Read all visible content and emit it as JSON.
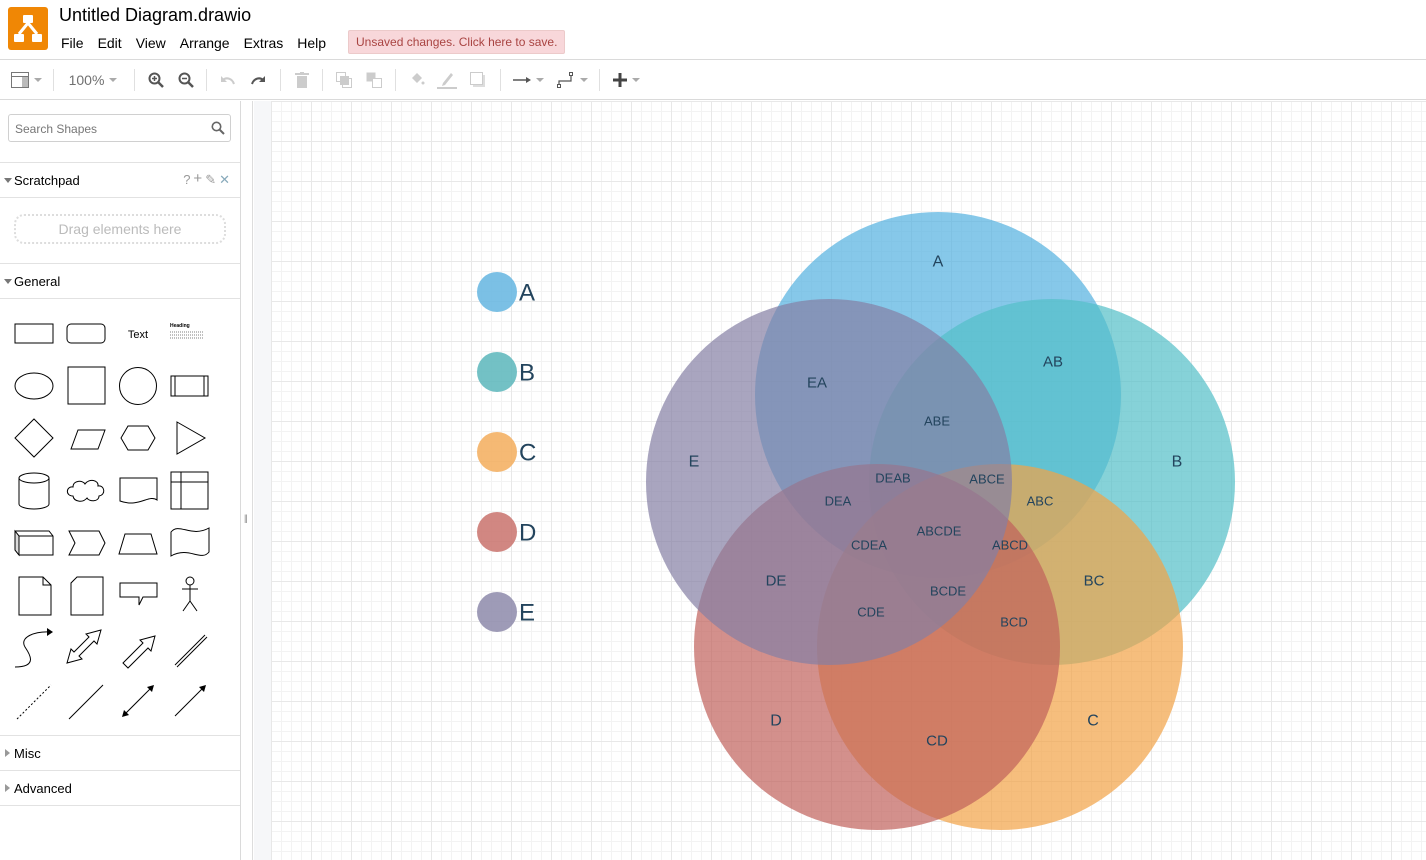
{
  "app": {
    "title": "Untitled Diagram.drawio",
    "logo_icon": "drawio-logo-icon",
    "unsaved_notice": "Unsaved changes. Click here to save."
  },
  "menu": [
    "File",
    "Edit",
    "View",
    "Arrange",
    "Extras",
    "Help"
  ],
  "toolbar": {
    "zoom_level": "100%",
    "buttons": [
      {
        "name": "format-panel-toggle",
        "icon": "layout-icon"
      },
      {
        "name": "zoom-in",
        "icon": "zoom-in-icon"
      },
      {
        "name": "zoom-out",
        "icon": "zoom-out-icon"
      },
      {
        "name": "undo",
        "icon": "undo-icon"
      },
      {
        "name": "redo",
        "icon": "redo-icon"
      },
      {
        "name": "delete",
        "icon": "trash-icon"
      },
      {
        "name": "to-front",
        "icon": "to-front-icon"
      },
      {
        "name": "to-back",
        "icon": "to-back-icon"
      },
      {
        "name": "fill-color",
        "icon": "paint-bucket-icon"
      },
      {
        "name": "line-color",
        "icon": "pencil-icon"
      },
      {
        "name": "shadow",
        "icon": "shadow-icon"
      },
      {
        "name": "connection",
        "icon": "arrow-right-icon"
      },
      {
        "name": "waypoints",
        "icon": "waypoint-icon"
      },
      {
        "name": "insert",
        "icon": "plus-icon"
      }
    ]
  },
  "sidebar": {
    "search_placeholder": "Search Shapes",
    "scratchpad": {
      "title": "Scratchpad",
      "actions": [
        "?",
        "+",
        "✎",
        "✕"
      ],
      "drop_hint": "Drag elements here"
    },
    "general": {
      "title": "General",
      "shapes": [
        "rectangle",
        "rounded-rectangle",
        "text",
        "textbox",
        "ellipse",
        "square",
        "circle",
        "process",
        "diamond",
        "parallelogram",
        "hexagon",
        "triangle",
        "cylinder",
        "cloud",
        "document",
        "internal-storage",
        "cube",
        "step",
        "trapezoid",
        "tape",
        "note",
        "card",
        "callout",
        "actor",
        "curved-arrow",
        "bidirectional-arrow",
        "arrow",
        "link",
        "dashed-line",
        "line",
        "bidirectional-connector",
        "directional-connector"
      ],
      "text_shape_label": "Text",
      "textbox_heading": "Heading"
    },
    "collapsed_sections": [
      "Misc",
      "Advanced"
    ]
  },
  "diagram": {
    "legend": [
      {
        "label": "A",
        "color": "#64b5e0"
      },
      {
        "label": "B",
        "color": "#5bb6bb"
      },
      {
        "label": "C",
        "color": "#f3ad5c"
      },
      {
        "label": "D",
        "color": "#c9726c"
      },
      {
        "label": "E",
        "color": "#8d89aa"
      }
    ],
    "sets": [
      {
        "id": "A",
        "color": "#53b0df"
      },
      {
        "id": "B",
        "color": "#52bfc7"
      },
      {
        "id": "C",
        "color": "#f2a346"
      },
      {
        "id": "D",
        "color": "#c0615b"
      },
      {
        "id": "E",
        "color": "#857fa4"
      }
    ],
    "region_labels": {
      "A": "A",
      "B": "B",
      "C": "C",
      "D": "D",
      "E": "E",
      "AB": "AB",
      "BC": "BC",
      "CD": "CD",
      "DE": "DE",
      "EA": "EA",
      "ABE": "ABE",
      "ABC": "ABC",
      "BCD": "BCD",
      "CDE": "CDE",
      "DEA": "DEA",
      "DEAB": "DEAB",
      "ABCE": "ABCE",
      "ABCD": "ABCD",
      "BCDE": "BCDE",
      "CDEA": "CDEA",
      "ABCDE": "ABCDE"
    }
  }
}
